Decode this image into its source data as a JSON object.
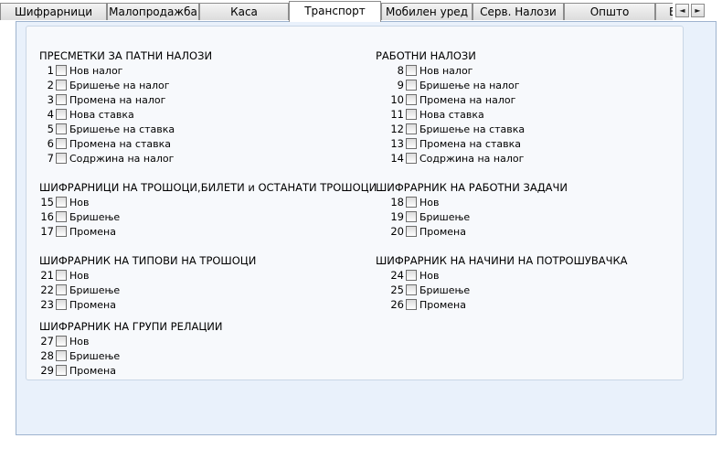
{
  "tabs": [
    {
      "label": "Шифрарници",
      "active": false
    },
    {
      "label": "Малопродажба",
      "active": false
    },
    {
      "label": "Каса",
      "active": false
    },
    {
      "label": "Транспорт",
      "active": true
    },
    {
      "label": "Мобилен уред",
      "active": false
    },
    {
      "label": "Серв. Налози",
      "active": false
    },
    {
      "label": "Општо",
      "active": false
    },
    {
      "label": "Е",
      "active": false
    }
  ],
  "tab_scroll": {
    "left_arrow": "◄",
    "right_arrow": "►"
  },
  "sections": [
    {
      "title": "ПРЕСМЕТКИ ЗА  ПАТНИ НАЛОЗИ",
      "items": [
        {
          "num": "1",
          "label": "Нов налог",
          "checked": false
        },
        {
          "num": "2",
          "label": "Бришење на налог",
          "checked": false
        },
        {
          "num": "3",
          "label": "Промена на налог",
          "checked": false
        },
        {
          "num": "4",
          "label": "Нова ставка",
          "checked": false
        },
        {
          "num": "5",
          "label": "Бришење на ставка",
          "checked": false
        },
        {
          "num": "6",
          "label": "Промена на ставка",
          "checked": false
        },
        {
          "num": "7",
          "label": "Содржина на налог",
          "checked": false
        }
      ]
    },
    {
      "title": "РАБОТНИ НАЛОЗИ",
      "items": [
        {
          "num": "8",
          "label": "Нов налог",
          "checked": false
        },
        {
          "num": "9",
          "label": "Бришење на налог",
          "checked": false
        },
        {
          "num": "10",
          "label": "Промена на налог",
          "checked": false
        },
        {
          "num": "11",
          "label": "Нова ставка",
          "checked": false
        },
        {
          "num": "12",
          "label": "Бришење на ставка",
          "checked": false
        },
        {
          "num": "13",
          "label": "Промена на ставка",
          "checked": false
        },
        {
          "num": "14",
          "label": "Содржина на налог",
          "checked": false
        }
      ]
    },
    {
      "title": "ШИФРАРНИЦИ НА ТРОШОЦИ,БИЛЕТИ и ОСТАНАТИ ТРОШОЦИ",
      "items": [
        {
          "num": "15",
          "label": "Нов",
          "checked": false
        },
        {
          "num": "16",
          "label": "Бришење",
          "checked": false
        },
        {
          "num": "17",
          "label": "Промена",
          "checked": false
        }
      ]
    },
    {
      "title": "ШИФРАРНИК НА РАБОТНИ ЗАДАЧИ",
      "items": [
        {
          "num": "18",
          "label": "Нов",
          "checked": false
        },
        {
          "num": "19",
          "label": "Бришење",
          "checked": false
        },
        {
          "num": "20",
          "label": "Промена",
          "checked": false
        }
      ]
    },
    {
      "title": "ШИФРАРНИК НА ТИПОВИ НА ТРОШОЦИ",
      "items": [
        {
          "num": "21",
          "label": "Нов",
          "checked": false
        },
        {
          "num": "22",
          "label": "Бришење",
          "checked": false
        },
        {
          "num": "23",
          "label": "Промена",
          "checked": false
        }
      ]
    },
    {
      "title": "ШИФРАРНИК НА НАЧИНИ НА ПОТРОШУВАЧКА",
      "items": [
        {
          "num": "24",
          "label": "Нов",
          "checked": false
        },
        {
          "num": "25",
          "label": "Бришење",
          "checked": false
        },
        {
          "num": "26",
          "label": "Промена",
          "checked": false
        }
      ]
    },
    {
      "title": "ШИФРАРНИК НА ГРУПИ РЕЛАЦИИ",
      "items": [
        {
          "num": "27",
          "label": "Нов",
          "checked": false
        },
        {
          "num": "28",
          "label": "Бришење",
          "checked": false
        },
        {
          "num": "29",
          "label": "Промена",
          "checked": false
        }
      ]
    }
  ]
}
